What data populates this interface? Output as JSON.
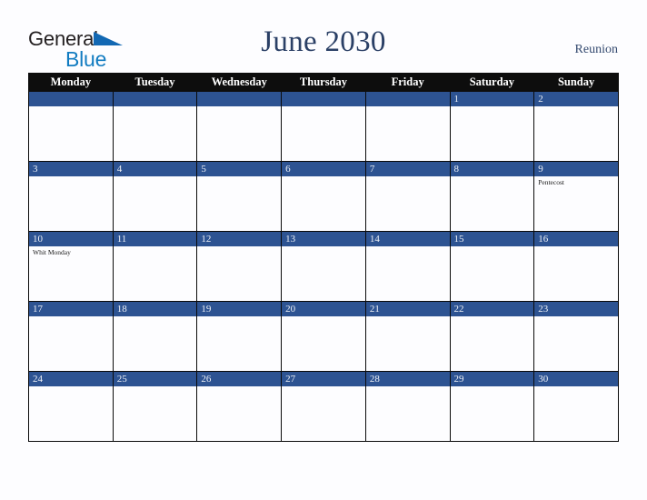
{
  "brand": {
    "name_part1": "General",
    "name_part2": "Blue",
    "triangle_icon": "triangle-icon",
    "color_dark": "#231f20",
    "color_blue": "#127cc1"
  },
  "header": {
    "title": "June 2030",
    "region": "Reunion",
    "title_color": "#2b4066"
  },
  "calendar": {
    "weekday_headers": [
      "Monday",
      "Tuesday",
      "Wednesday",
      "Thursday",
      "Friday",
      "Saturday",
      "Sunday"
    ],
    "header_bg": "#0d0d0d",
    "daybar_bg": "#2d5392",
    "weeks": [
      [
        {
          "day": "",
          "events": []
        },
        {
          "day": "",
          "events": []
        },
        {
          "day": "",
          "events": []
        },
        {
          "day": "",
          "events": []
        },
        {
          "day": "",
          "events": []
        },
        {
          "day": "1",
          "events": []
        },
        {
          "day": "2",
          "events": []
        }
      ],
      [
        {
          "day": "3",
          "events": []
        },
        {
          "day": "4",
          "events": []
        },
        {
          "day": "5",
          "events": []
        },
        {
          "day": "6",
          "events": []
        },
        {
          "day": "7",
          "events": []
        },
        {
          "day": "8",
          "events": []
        },
        {
          "day": "9",
          "events": [
            "Pentecost"
          ]
        }
      ],
      [
        {
          "day": "10",
          "events": [
            "Whit Monday"
          ]
        },
        {
          "day": "11",
          "events": []
        },
        {
          "day": "12",
          "events": []
        },
        {
          "day": "13",
          "events": []
        },
        {
          "day": "14",
          "events": []
        },
        {
          "day": "15",
          "events": []
        },
        {
          "day": "16",
          "events": []
        }
      ],
      [
        {
          "day": "17",
          "events": []
        },
        {
          "day": "18",
          "events": []
        },
        {
          "day": "19",
          "events": []
        },
        {
          "day": "20",
          "events": []
        },
        {
          "day": "21",
          "events": []
        },
        {
          "day": "22",
          "events": []
        },
        {
          "day": "23",
          "events": []
        }
      ],
      [
        {
          "day": "24",
          "events": []
        },
        {
          "day": "25",
          "events": []
        },
        {
          "day": "26",
          "events": []
        },
        {
          "day": "27",
          "events": []
        },
        {
          "day": "28",
          "events": []
        },
        {
          "day": "29",
          "events": []
        },
        {
          "day": "30",
          "events": []
        }
      ]
    ]
  }
}
